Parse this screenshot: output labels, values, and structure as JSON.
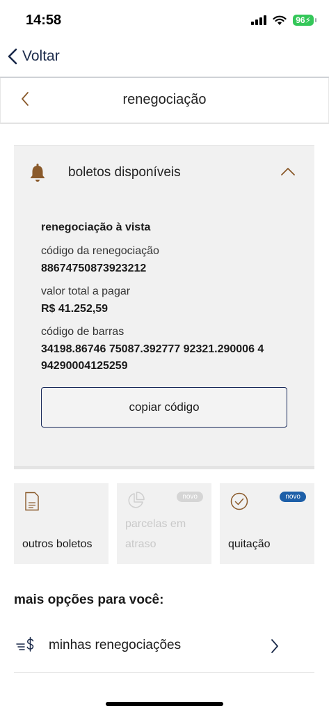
{
  "status_bar": {
    "time": "14:58",
    "battery": "96"
  },
  "nav": {
    "back_label": "Voltar"
  },
  "header": {
    "title": "renegociação"
  },
  "boletos_card": {
    "title": "boletos disponíveis",
    "heading": "renegociação à vista",
    "codigo_label": "código da renegociação",
    "codigo_value": "88674750873923212",
    "valor_label": "valor total a pagar",
    "valor_value": "R$ 41.252,59",
    "barras_label": "código de barras",
    "barras_line1": "34198.86746 75087.392777 92321.290006 4",
    "barras_line2": "94290004125259",
    "copy_button": "copiar código"
  },
  "tiles": [
    {
      "label": "outros boletos",
      "icon": "document-icon",
      "enabled": true
    },
    {
      "label_line1": "parcelas em",
      "label_line2": "atraso",
      "icon": "pie-chart-icon",
      "badge": "novo",
      "enabled": false
    },
    {
      "label": "quitação",
      "icon": "check-circle-icon",
      "badge": "novo",
      "enabled": true
    }
  ],
  "more_options": {
    "title": "mais opções para você:",
    "items": [
      {
        "label": "minhas renegociações",
        "icon": "money-lines-icon"
      }
    ]
  },
  "colors": {
    "accent_brown": "#8a5a2b",
    "navy": "#18295a",
    "badge_blue": "#1d5fa8",
    "badge_gray": "#d5d5d5"
  }
}
